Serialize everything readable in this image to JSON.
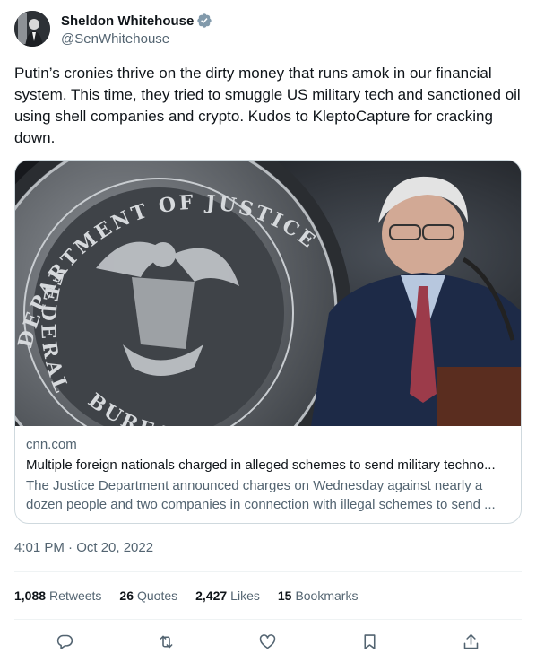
{
  "author": {
    "display_name": "Sheldon Whitehouse",
    "handle": "@SenWhitehouse",
    "verified": true
  },
  "tweet": {
    "text": "Putin’s cronies thrive on the dirty money that runs amok in our financial system. This time, they tried to smuggle US military tech and sanctioned oil using shell companies and crypto. Kudos to KleptoCapture for cracking down.",
    "timestamp": "4:01 PM · Oct 20, 2022"
  },
  "card": {
    "domain": "cnn.com",
    "title": "Multiple foreign nationals charged in alleged schemes to send military techno...",
    "description": "The Justice Department announced charges on Wednesday against nearly a dozen people and two companies in connection with illegal schemes to send ...",
    "seal_text_top": "DEPARTMENT OF JUSTICE",
    "seal_text_left": "FEDERAL",
    "seal_text_bottom": "BUREAU OF PRISONS"
  },
  "stats": {
    "retweets": {
      "count": "1,088",
      "label": "Retweets"
    },
    "quotes": {
      "count": "26",
      "label": "Quotes"
    },
    "likes": {
      "count": "2,427",
      "label": "Likes"
    },
    "bookmarks": {
      "count": "15",
      "label": "Bookmarks"
    }
  },
  "actions": [
    {
      "name": "reply",
      "icon": "reply-icon"
    },
    {
      "name": "retweet",
      "icon": "retweet-icon"
    },
    {
      "name": "like",
      "icon": "heart-icon"
    },
    {
      "name": "bookmark",
      "icon": "bookmark-icon"
    },
    {
      "name": "share",
      "icon": "share-icon"
    }
  ],
  "colors": {
    "text_primary": "#0f1419",
    "text_secondary": "#536471",
    "verified_blue": "#829aab",
    "border": "#cfd9de"
  }
}
